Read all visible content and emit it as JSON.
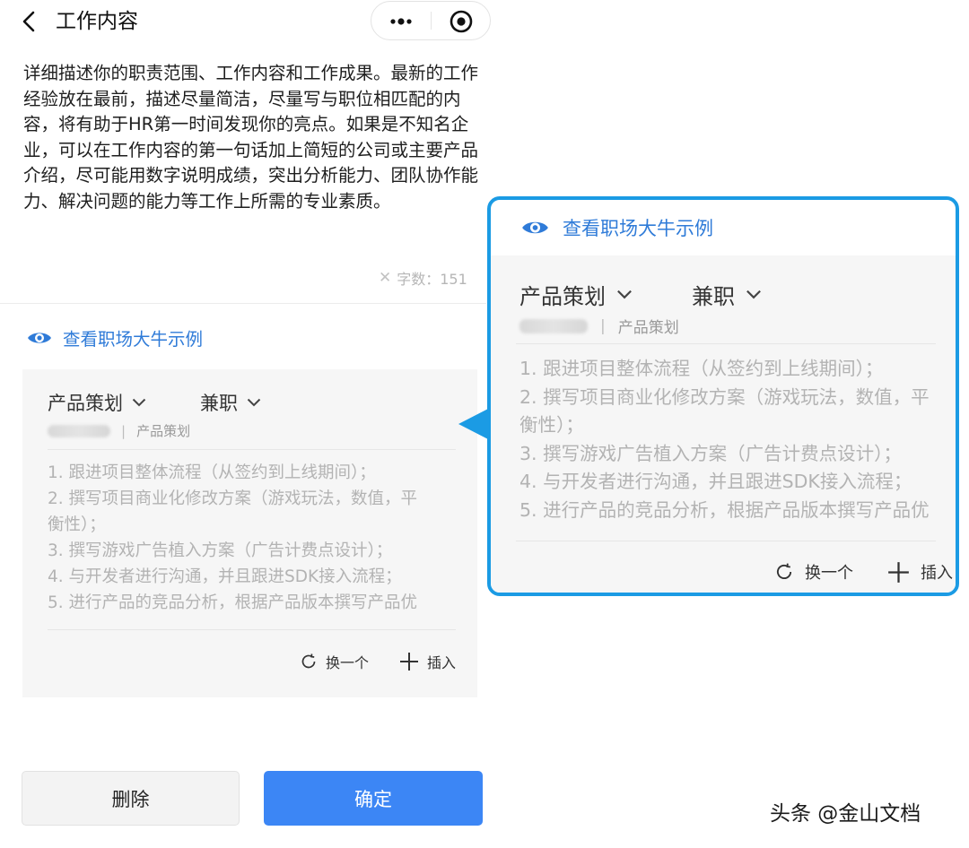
{
  "header": {
    "title": "工作内容"
  },
  "description": {
    "text": "详细描述你的职责范围、工作内容和工作成果。最新的工作经验放在最前，描述尽量简洁，尽量写与职位相匹配的内容，将有助于HR第一时间发现你的亮点。如果是不知名企业，可以在工作内容的第一句话加上简短的公司或主要产品介绍，尽可能用数字说明成绩，突出分析能力、团队协作能力、解决问题的能力等工作上所需的专业素质。",
    "count_label": "字数：151"
  },
  "example": {
    "link_label": "查看职场大牛示例",
    "role": "产品策划",
    "job_type": "兼职",
    "meta_role": "产品策划",
    "separator": "|",
    "items": [
      "1. 跟进项目整体流程（从签约到上线期间）；",
      "2. 撰写项目商业化修改方案（游戏玩法，数值，平",
      "衡性）；",
      "3. 撰写游戏广告植入方案（广告计费点设计）；",
      "4. 与开发者进行沟通，并且跟进SDK接入流程；",
      "5. 进行产品的竞品分析，根据产品版本撰写产品优"
    ],
    "actions": {
      "swap_label": "换一个",
      "insert_label": "插入"
    }
  },
  "buttons": {
    "delete_label": "删除",
    "confirm_label": "确定"
  },
  "watermark": "头条 @金山文档",
  "colors": {
    "accent_blue": "#2f7bd8",
    "confirm_blue": "#3c86f5",
    "callout_border": "#1b9be4"
  }
}
